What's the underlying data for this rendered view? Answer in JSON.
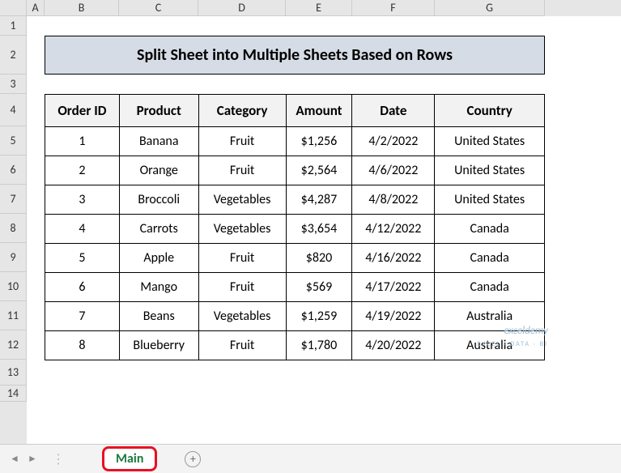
{
  "cols": [
    "A",
    "B",
    "C",
    "D",
    "E",
    "F",
    "G"
  ],
  "rows": [
    "1",
    "2",
    "3",
    "4",
    "5",
    "6",
    "7",
    "8",
    "9",
    "10",
    "11",
    "12",
    "13",
    "14"
  ],
  "title": "Split Sheet into Multiple Sheets Based on Rows",
  "headers": {
    "order_id": "Order ID",
    "product": "Product",
    "category": "Category",
    "amount": "Amount",
    "date": "Date",
    "country": "Country"
  },
  "data_rows": [
    {
      "id": "1",
      "product": "Banana",
      "category": "Fruit",
      "amount": "$1,256",
      "date": "4/2/2022",
      "country": "United States"
    },
    {
      "id": "2",
      "product": "Orange",
      "category": "Fruit",
      "amount": "$2,564",
      "date": "4/6/2022",
      "country": "United States"
    },
    {
      "id": "3",
      "product": "Broccoli",
      "category": "Vegetables",
      "amount": "$4,287",
      "date": "4/8/2022",
      "country": "United States"
    },
    {
      "id": "4",
      "product": "Carrots",
      "category": "Vegetables",
      "amount": "$3,654",
      "date": "4/12/2022",
      "country": "Canada"
    },
    {
      "id": "5",
      "product": "Apple",
      "category": "Fruit",
      "amount": "$820",
      "date": "4/16/2022",
      "country": "Canada"
    },
    {
      "id": "6",
      "product": "Mango",
      "category": "Fruit",
      "amount": "$569",
      "date": "4/17/2022",
      "country": "Canada"
    },
    {
      "id": "7",
      "product": "Beans",
      "category": "Vegetables",
      "amount": "$1,259",
      "date": "4/19/2022",
      "country": "Australia"
    },
    {
      "id": "8",
      "product": "Blueberry",
      "category": "Fruit",
      "amount": "$1,780",
      "date": "4/20/2022",
      "country": "Australia"
    }
  ],
  "watermark": {
    "brand": "exceldemy",
    "tag": "EXCEL · DATA · BI"
  },
  "tabs": {
    "active": "Main",
    "add": "+",
    "prev": "◄",
    "next": "►"
  }
}
